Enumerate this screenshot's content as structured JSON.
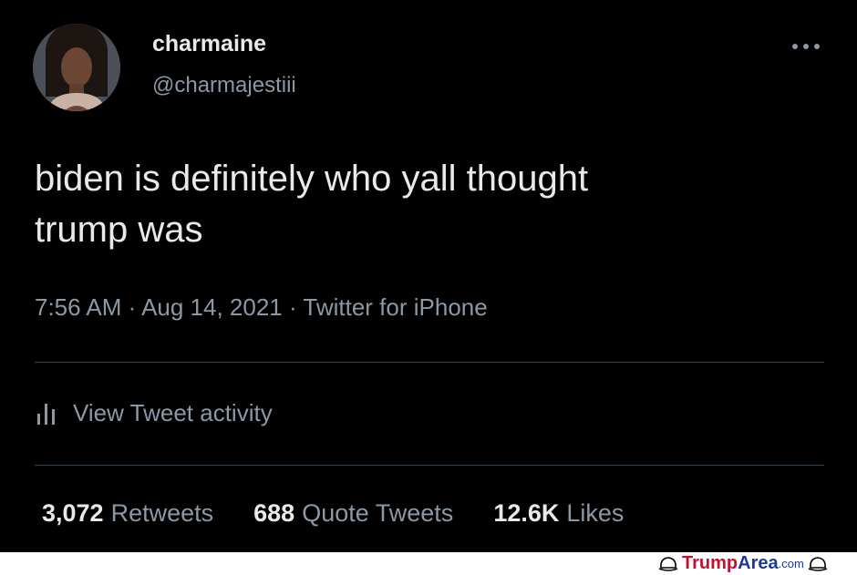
{
  "tweet": {
    "author": {
      "display_name": "charmaine",
      "handle": "@charmajestiii"
    },
    "text_line1": "biden is definitely who yall thought",
    "text_line2": "trump was",
    "meta": "7:56 AM · Aug 14, 2021 · Twitter for iPhone",
    "activity_label": "View Tweet activity",
    "stats": [
      {
        "count": "3,072",
        "label": "Retweets"
      },
      {
        "count": "688",
        "label": "Quote Tweets"
      },
      {
        "count": "12.6K",
        "label": "Likes"
      }
    ]
  },
  "watermark": {
    "part1": "Trump",
    "part2": "Area",
    "part3": ".com"
  },
  "icons": {
    "more": "more-horizontal-icon",
    "activity": "bar-chart-icon",
    "watermark": "hat-icon"
  },
  "colors": {
    "background": "#000000",
    "primary_text": "#e7e9ea",
    "secondary_text": "#8b98a5",
    "divider": "#38444d",
    "watermark_red": "#c8102e",
    "watermark_blue": "#1f3a93"
  }
}
